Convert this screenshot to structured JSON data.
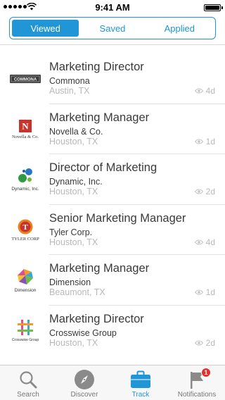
{
  "status_bar": {
    "time": "9:41 AM"
  },
  "segmented_control": {
    "tabs": [
      "Viewed",
      "Saved",
      "Applied"
    ],
    "selected": "Viewed"
  },
  "jobs": [
    {
      "title": "Marketing Director",
      "company": "Commona",
      "location": "Austin, TX",
      "age": "4d",
      "logo": "commona-logo",
      "logo_text": "COMMONA"
    },
    {
      "title": "Marketing Manager",
      "company": "Novella & Co.",
      "location": "Houston, TX",
      "age": "1d",
      "logo": "novella-logo",
      "logo_text": "Novella & Co."
    },
    {
      "title": "Director of Marketing",
      "company": "Dynamic, Inc.",
      "location": "Houston, TX",
      "age": "2d",
      "logo": "dynamic-logo",
      "logo_text": "Dynamic, Inc."
    },
    {
      "title": "Senior Marketing Manager",
      "company": "Tyler Corp.",
      "location": "Houston, TX",
      "age": "4d",
      "logo": "tyler-logo",
      "logo_text": "TYLER CORP"
    },
    {
      "title": "Marketing Manager",
      "company": "Dimension",
      "location": "Beaumont, TX",
      "age": "1d",
      "logo": "dimension-logo",
      "logo_text": "Dimension"
    },
    {
      "title": "Marketing Director",
      "company": "Crosswise Group",
      "location": "Houston, TX",
      "age": "2d",
      "logo": "crosswise-logo",
      "logo_text": "Crosswise Group"
    }
  ],
  "tab_bar": {
    "items": [
      {
        "label": "Search",
        "icon": "search-icon"
      },
      {
        "label": "Discover",
        "icon": "compass-icon"
      },
      {
        "label": "Track",
        "icon": "briefcase-icon"
      },
      {
        "label": "Notifications",
        "icon": "flag-icon",
        "badge": "1"
      }
    ],
    "active": "Track"
  },
  "colors": {
    "accent": "#2196d6",
    "badge": "#e0312f",
    "muted_text": "#b8b8b8"
  }
}
